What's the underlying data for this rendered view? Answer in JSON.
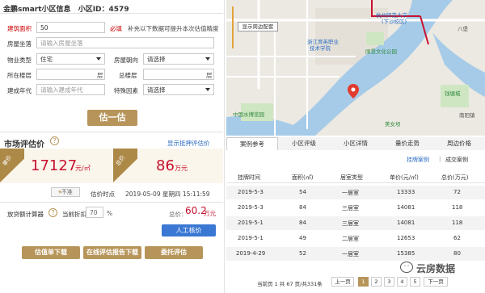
{
  "header": {
    "title": "金鹏smart小区信息",
    "id_label": "小区ID：",
    "id_value": "4579"
  },
  "form": {
    "area_label": "建筑面积",
    "area_value": "50",
    "required_label": "必填",
    "hint": "补充以下数据可提升本次估值精度",
    "layout_label": "房屋坐落",
    "layout_placeholder": "请输入房屋坐落",
    "type_label": "物业类型",
    "type_value": "住宅",
    "orient_label": "房屋朝向",
    "orient_value": "请选择",
    "floor_label": "所在楼层",
    "floor_unit": "层",
    "total_floor_label": "总楼层",
    "total_floor_unit": "层",
    "year_label": "建成年代",
    "year_placeholder": "请输入建成年代",
    "special_label": "特殊因素",
    "special_value": "请选择",
    "estimate_button": "估一估"
  },
  "valuation": {
    "heading": "市场评估价",
    "show_mortgage_link": "显示抵押评估价",
    "unit_price_badge": "单价",
    "unit_price_value": "17127",
    "unit_price_unit": "元/㎡",
    "total_price_badge": "总价",
    "total_price_value": "86",
    "total_price_unit": "万元",
    "unsatisfied_label": "不准",
    "time_label": "估价时点",
    "time_value": "2019-05-09 星期四 15:11:59",
    "loan_label": "放贷额计算器",
    "discount_label": "当前折扣",
    "discount_value": "70",
    "discount_unit": "%",
    "loan_total_label": "总价：",
    "loan_total_value": "60.2",
    "loan_total_unit": "万元",
    "manual_button": "人工核价",
    "report_button": "估值单下载",
    "online_report_button": "在线评估报告下载",
    "entrust_button": "委托评估"
  },
  "map": {
    "show_surroundings": "显示周边配套",
    "labels": [
      "杭州师范大学",
      "(下沙校区)",
      "浙江育英职业",
      "技术学院",
      "围垦文化公园",
      "中国水博览园",
      "美女坝",
      "钱塘城",
      "南阳镇",
      "八堡"
    ]
  },
  "tabs": [
    "案例参考",
    "小区评级",
    "小区详情",
    "量价走势",
    "周边价格"
  ],
  "case_tabs": {
    "listed": "挂牌案例",
    "sep": "|",
    "sold": "成交案例"
  },
  "table": {
    "headers": [
      "挂牌时间",
      "面积(㎡)",
      "居室类型",
      "单价(元/㎡)",
      "总价(万元)"
    ],
    "rows": [
      [
        "2019-5-3",
        "54",
        "一居室",
        "13333",
        "72"
      ],
      [
        "2019-5-3",
        "84",
        "三居室",
        "14081",
        "118"
      ],
      [
        "2019-5-1",
        "84",
        "三居室",
        "14081",
        "118"
      ],
      [
        "2019-5-1",
        "49",
        "二居室",
        "12653",
        "62"
      ],
      [
        "2019-4-29",
        "52",
        "一居室",
        "15385",
        "80"
      ]
    ]
  },
  "pagination": {
    "summary": "当前页 1 共 67 页/共331条",
    "prev": "上一页",
    "pages": [
      "1",
      "2",
      "3",
      "4",
      "5"
    ],
    "next": "下一页"
  },
  "watermark": "云房数据",
  "colors": {
    "gold": "#b7955a",
    "accent_red": "#c8102e",
    "link_blue": "#2a6cc1",
    "map_water": "#a6cbe8",
    "map_green": "#cfe6c3"
  }
}
